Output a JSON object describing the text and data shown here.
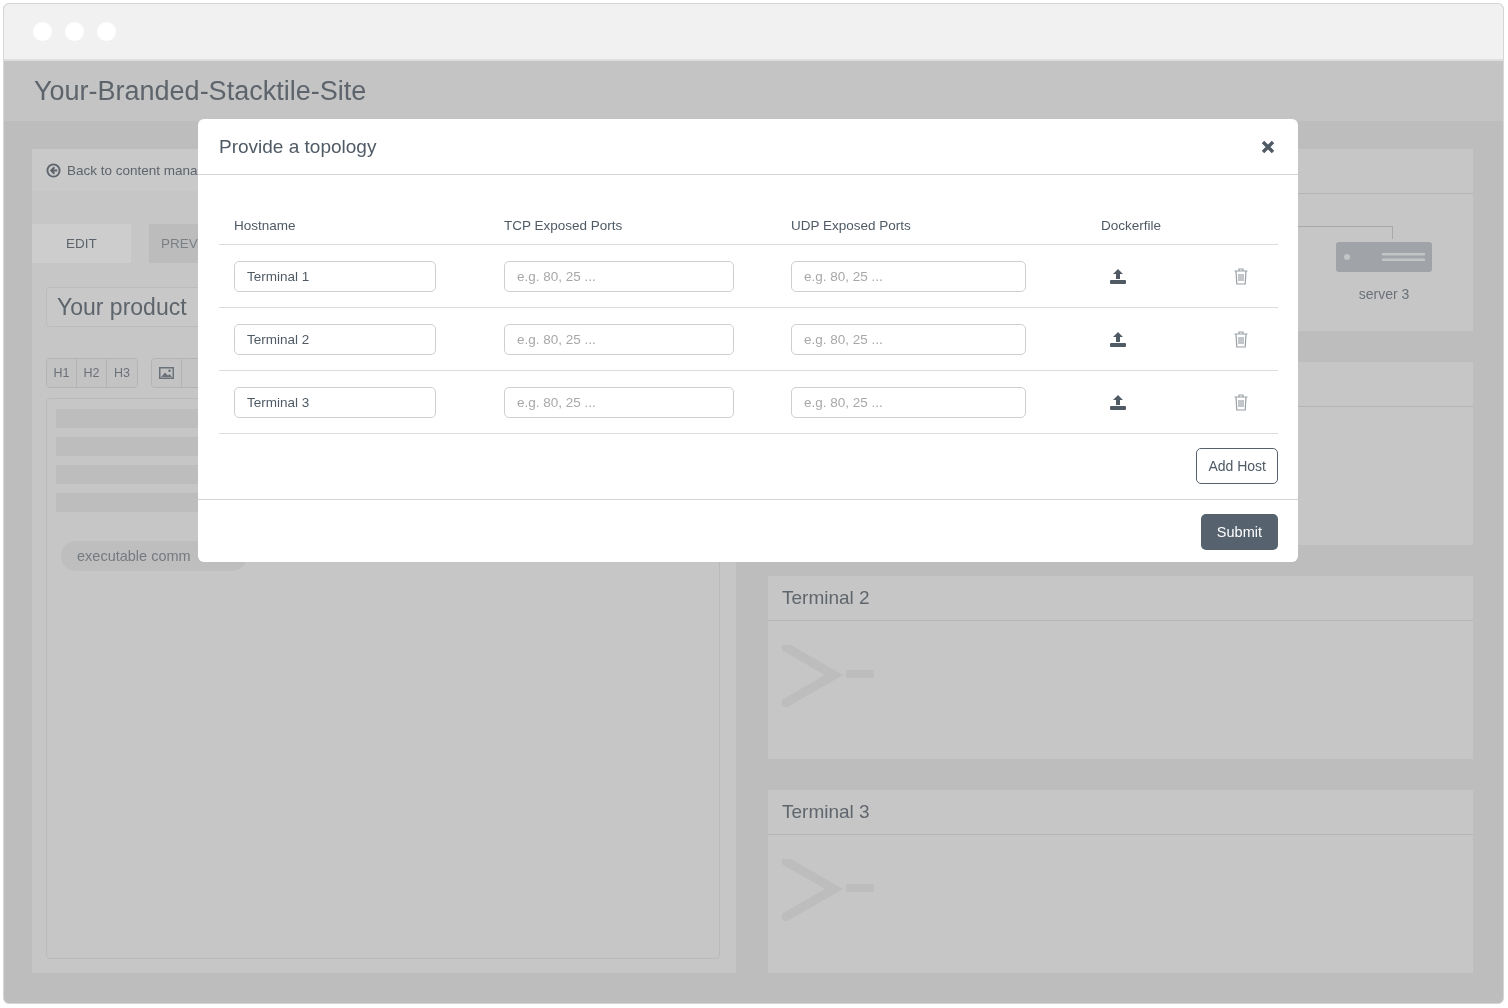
{
  "site": {
    "title": "Your-Branded-Stacktile-Site"
  },
  "editor": {
    "back_link": "Back to content mana",
    "tabs": [
      {
        "label": "EDIT",
        "selected": true
      },
      {
        "label": "PREV",
        "selected": false
      }
    ],
    "title_field": "Your product",
    "toolbar": [
      "H1",
      "H2",
      "H3"
    ],
    "command_tag": "executable comm"
  },
  "topology": {
    "node": "server 3"
  },
  "terminals": [
    {
      "title": "Terminal 2"
    },
    {
      "title": "Terminal 3"
    }
  ],
  "modal": {
    "title": "Provide a topology",
    "columns": [
      "Hostname",
      "TCP Exposed Ports",
      "UDP Exposed Ports",
      "Dockerfile"
    ],
    "rows": [
      {
        "hostname": "Terminal 1",
        "tcp": {
          "placeholder": "e.g. 80, 25 ..."
        },
        "udp": {
          "placeholder": "e.g. 80, 25 ..."
        }
      },
      {
        "hostname": "Terminal 2",
        "tcp": {
          "placeholder": "e.g. 80, 25 ..."
        },
        "udp": {
          "placeholder": "e.g. 80, 25 ..."
        }
      },
      {
        "hostname": "Terminal 3",
        "tcp": {
          "placeholder": "e.g. 80, 25 ..."
        },
        "udp": {
          "placeholder": "e.g. 80, 25 ..."
        }
      }
    ],
    "add_button": "Add Host",
    "submit_button": "Submit"
  }
}
